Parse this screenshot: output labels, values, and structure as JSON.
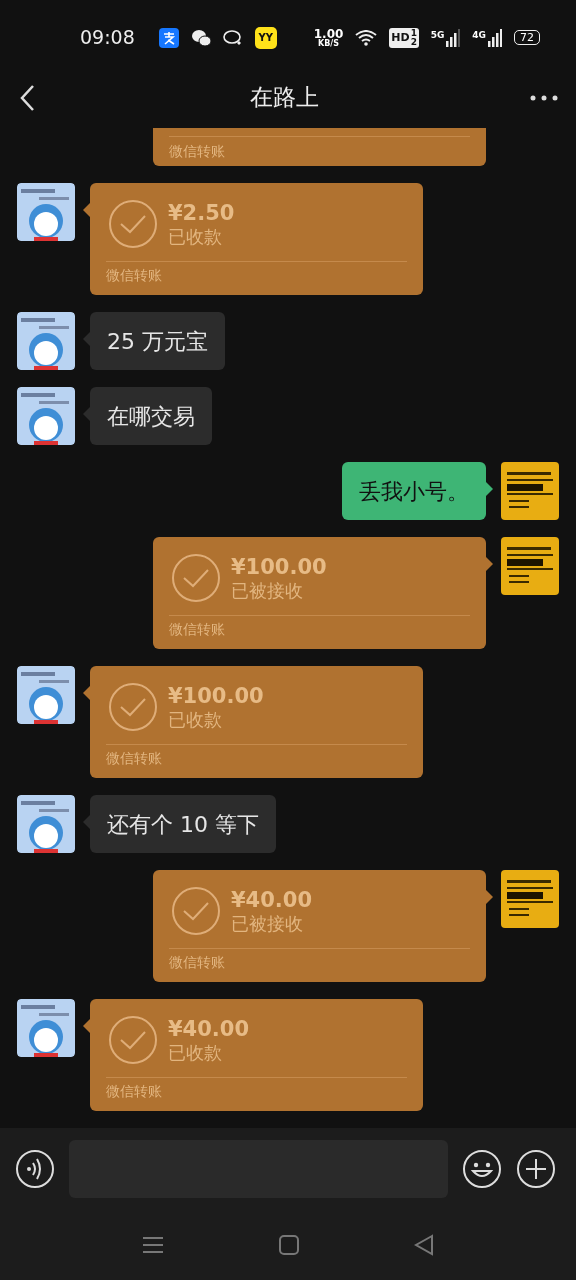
{
  "status_bar": {
    "time": "09:08",
    "yy_label": "YY",
    "speed": "1.00",
    "speed_unit": "KB/S",
    "hd": "HD",
    "hd_sub": "12",
    "net1": "5G",
    "net2": "4G",
    "battery": "72"
  },
  "header": {
    "title": "在路上"
  },
  "messages": [
    {
      "kind": "transfer",
      "outgoing": true,
      "cut": true,
      "footer": "微信转账"
    },
    {
      "kind": "transfer",
      "outgoing": false,
      "cut": false,
      "amount": "¥2.50",
      "status": "已收款",
      "footer": "微信转账"
    },
    {
      "kind": "text",
      "outgoing": false,
      "text": "25 万元宝"
    },
    {
      "kind": "text",
      "outgoing": false,
      "text": "在哪交易"
    },
    {
      "kind": "text",
      "outgoing": true,
      "text": "丢我小号。"
    },
    {
      "kind": "transfer",
      "outgoing": true,
      "cut": false,
      "amount": "¥100.00",
      "status": "已被接收",
      "footer": "微信转账"
    },
    {
      "kind": "transfer",
      "outgoing": false,
      "cut": false,
      "amount": "¥100.00",
      "status": "已收款",
      "footer": "微信转账"
    },
    {
      "kind": "text",
      "outgoing": false,
      "text": "还有个 10 等下"
    },
    {
      "kind": "transfer",
      "outgoing": true,
      "cut": false,
      "amount": "¥40.00",
      "status": "已被接收",
      "footer": "微信转账"
    },
    {
      "kind": "transfer",
      "outgoing": false,
      "cut": false,
      "amount": "¥40.00",
      "status": "已收款",
      "footer": "微信转账"
    }
  ]
}
